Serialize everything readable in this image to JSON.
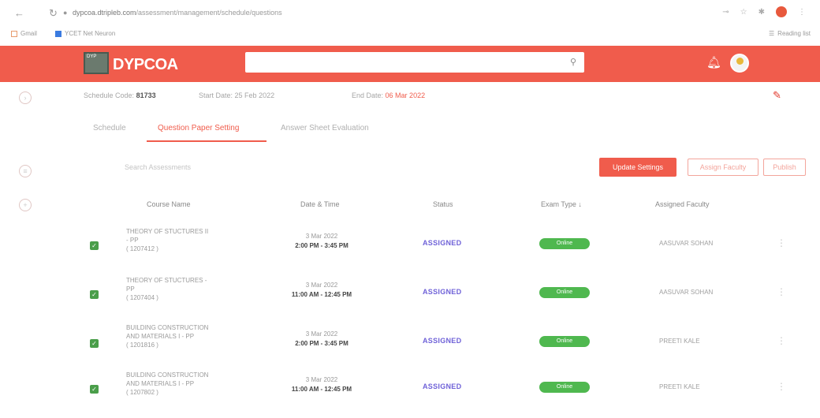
{
  "browser": {
    "url_host": "dypcoa.dtripleb.com",
    "url_path": "/assessment/management/schedule/questions",
    "bookmarks": [
      {
        "label": "Gmail"
      },
      {
        "label": "YCET Net Neuron"
      }
    ],
    "reading_list": "Reading list"
  },
  "header": {
    "logo_text": "DYP",
    "title": "DYPCOA",
    "search_placeholder": "Search",
    "brand_color": "#f05c4c"
  },
  "schedule": {
    "code_label": "Schedule Code:",
    "code_value": "81733",
    "start_label": "Start Date:",
    "start_value": "25 Feb 2022",
    "end_label": "End Date:",
    "end_value": "06 Mar 2022"
  },
  "tabs": [
    {
      "label": "Schedule"
    },
    {
      "label": "Question Paper Setting"
    },
    {
      "label": "Answer Sheet Evaluation"
    }
  ],
  "controls": {
    "search_placeholder": "Search Assessments",
    "update_button": "Update Settings",
    "assign_faculty_button": "Assign Faculty",
    "publish_button": "Publish"
  },
  "table": {
    "columns": [
      "Course Name",
      "Date & Time",
      "Status",
      "Exam Type",
      "Assigned Faculty"
    ],
    "rows": [
      {
        "course_line1": "THEORY OF STUCTURES II",
        "course_line2": "- PP",
        "course_code": "( 1207412 )",
        "date": "3 Mar 2022",
        "time": "2:00 PM - 3:45 PM",
        "status": "ASSIGNED",
        "exam_type": "Online",
        "faculty": "Aasuvar Sohan"
      },
      {
        "course_line1": "THEORY OF STUCTURES -",
        "course_line2": "PP",
        "course_code": "( 1207404 )",
        "date": "3 Mar 2022",
        "time": "11:00 AM - 12:45 PM",
        "status": "ASSIGNED",
        "exam_type": "Online",
        "faculty": "Aasuvar Sohan"
      },
      {
        "course_line1": "BUILDING CONSTRUCTION",
        "course_line2": "AND MATERIALS I - PP",
        "course_code": "( 1201816 )",
        "date": "3 Mar 2022",
        "time": "2:00 PM - 3:45 PM",
        "status": "ASSIGNED",
        "exam_type": "Online",
        "faculty": "PREETI KALE"
      },
      {
        "course_line1": "BUILDING CONSTRUCTION",
        "course_line2": "AND MATERIALS I - PP",
        "course_code": "( 1207802 )",
        "date": "3 Mar 2022",
        "time": "11:00 AM - 12:45 PM",
        "status": "ASSIGNED",
        "exam_type": "Online",
        "faculty": "PREETI KALE"
      }
    ]
  }
}
